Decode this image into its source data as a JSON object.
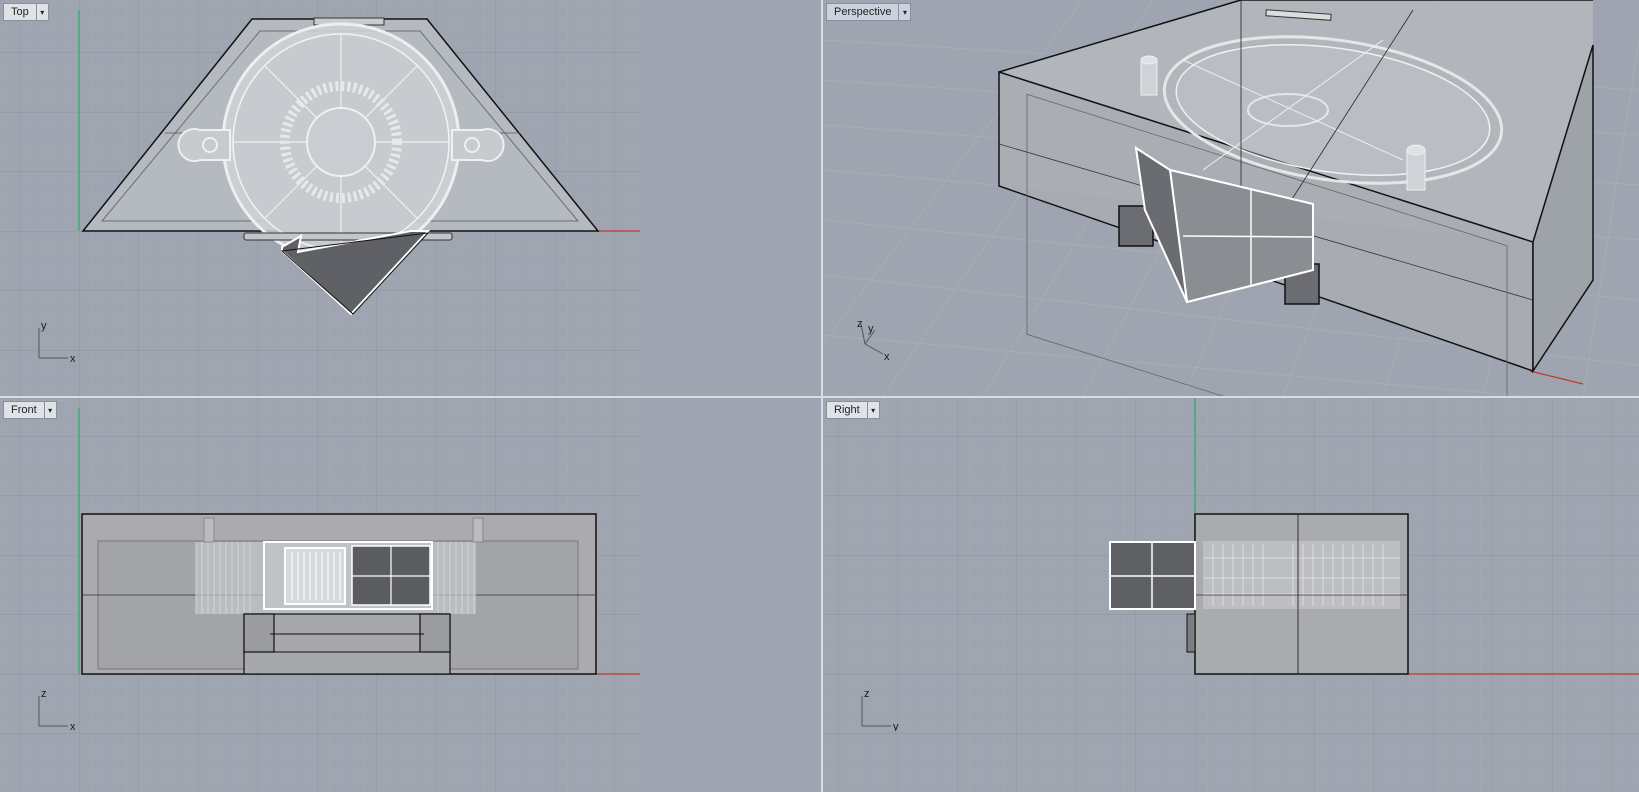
{
  "viewports": {
    "top": {
      "label": "Top",
      "gizmo": [
        "y",
        "x"
      ]
    },
    "perspective": {
      "label": "Perspective",
      "gizmo": [
        "z",
        "y",
        "x"
      ]
    },
    "front": {
      "label": "Front",
      "gizmo": [
        "z",
        "x"
      ]
    },
    "right": {
      "label": "Right",
      "gizmo": [
        "z",
        "y"
      ]
    }
  },
  "dropdown_glyph": "▾",
  "colors": {
    "viewport_bg": "#9ea5b0",
    "grid_minor": "#a9afb8",
    "grid_major": "#8c939e",
    "axis_x": "#c0392b",
    "axis_y": "#27ae60",
    "active_label_bg": "#c9d3df"
  }
}
